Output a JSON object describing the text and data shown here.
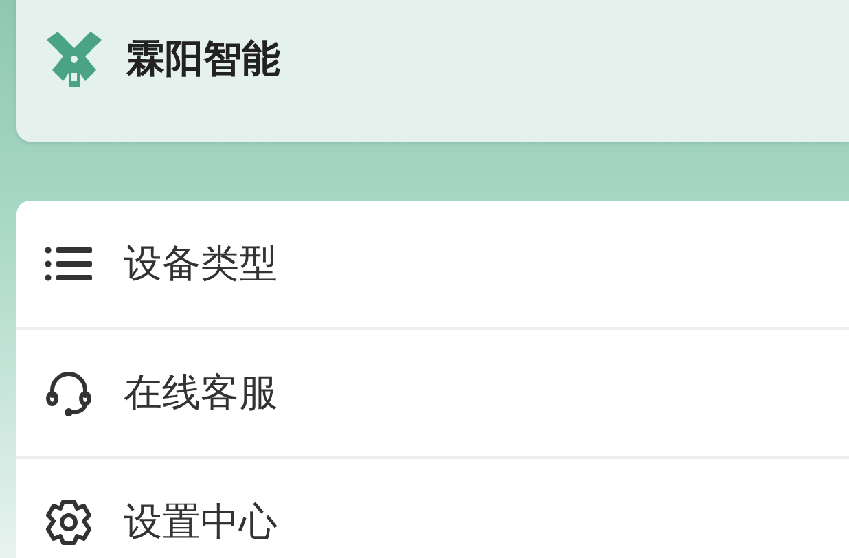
{
  "header": {
    "brand": "霖阳智能"
  },
  "menu": [
    {
      "kind": "list",
      "label": "设备类型"
    },
    {
      "kind": "support",
      "label": "在线客服"
    },
    {
      "kind": "settings",
      "label": "设置中心"
    }
  ]
}
